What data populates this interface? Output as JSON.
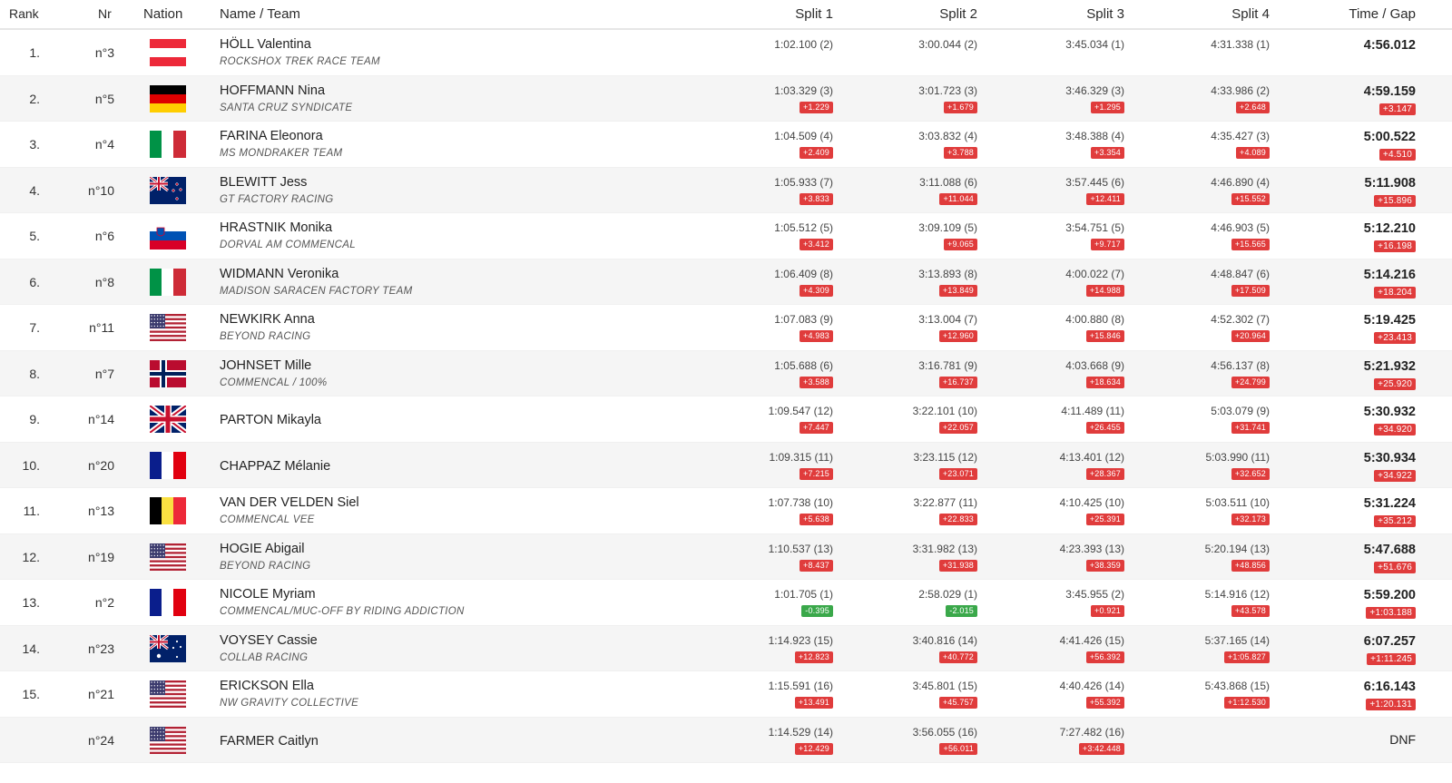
{
  "header": {
    "rank": "Rank",
    "nr": "Nr",
    "nation": "Nation",
    "name_team": "Name / Team",
    "split1": "Split 1",
    "split2": "Split 2",
    "split3": "Split 3",
    "split4": "Split 4",
    "time_gap": "Time / Gap"
  },
  "rows": [
    {
      "rank": "1.",
      "nr": "n°3",
      "flag": "AUT",
      "name": "HÖLL Valentina",
      "team": "ROCKSHOX TREK RACE TEAM",
      "s1": "1:02.100 (2)",
      "g1": "",
      "s2": "3:00.044 (2)",
      "g2": "",
      "s3": "3:45.034 (1)",
      "g3": "",
      "s4": "4:31.338 (1)",
      "g4": "",
      "time": "4:56.012",
      "gap": ""
    },
    {
      "rank": "2.",
      "nr": "n°5",
      "flag": "GER",
      "name": "HOFFMANN Nina",
      "team": "SANTA CRUZ SYNDICATE",
      "s1": "1:03.329 (3)",
      "g1": "+1.229",
      "s2": "3:01.723 (3)",
      "g2": "+1.679",
      "s3": "3:46.329 (3)",
      "g3": "+1.295",
      "s4": "4:33.986 (2)",
      "g4": "+2.648",
      "time": "4:59.159",
      "gap": "+3.147"
    },
    {
      "rank": "3.",
      "nr": "n°4",
      "flag": "ITA",
      "name": "FARINA Eleonora",
      "team": "MS MONDRAKER TEAM",
      "s1": "1:04.509 (4)",
      "g1": "+2.409",
      "s2": "3:03.832 (4)",
      "g2": "+3.788",
      "s3": "3:48.388 (4)",
      "g3": "+3.354",
      "s4": "4:35.427 (3)",
      "g4": "+4.089",
      "time": "5:00.522",
      "gap": "+4.510"
    },
    {
      "rank": "4.",
      "nr": "n°10",
      "flag": "NZL",
      "name": "BLEWITT Jess",
      "team": "GT FACTORY RACING",
      "s1": "1:05.933 (7)",
      "g1": "+3.833",
      "s2": "3:11.088 (6)",
      "g2": "+11.044",
      "s3": "3:57.445 (6)",
      "g3": "+12.411",
      "s4": "4:46.890 (4)",
      "g4": "+15.552",
      "time": "5:11.908",
      "gap": "+15.896"
    },
    {
      "rank": "5.",
      "nr": "n°6",
      "flag": "SLO",
      "name": "HRASTNIK Monika",
      "team": "DORVAL AM COMMENCAL",
      "s1": "1:05.512 (5)",
      "g1": "+3.412",
      "s2": "3:09.109 (5)",
      "g2": "+9.065",
      "s3": "3:54.751 (5)",
      "g3": "+9.717",
      "s4": "4:46.903 (5)",
      "g4": "+15.565",
      "time": "5:12.210",
      "gap": "+16.198"
    },
    {
      "rank": "6.",
      "nr": "n°8",
      "flag": "ITA",
      "name": "WIDMANN Veronika",
      "team": "MADISON SARACEN FACTORY TEAM",
      "s1": "1:06.409 (8)",
      "g1": "+4.309",
      "s2": "3:13.893 (8)",
      "g2": "+13.849",
      "s3": "4:00.022 (7)",
      "g3": "+14.988",
      "s4": "4:48.847 (6)",
      "g4": "+17.509",
      "time": "5:14.216",
      "gap": "+18.204"
    },
    {
      "rank": "7.",
      "nr": "n°11",
      "flag": "USA",
      "name": "NEWKIRK Anna",
      "team": "BEYOND RACING",
      "s1": "1:07.083 (9)",
      "g1": "+4.983",
      "s2": "3:13.004 (7)",
      "g2": "+12.960",
      "s3": "4:00.880 (8)",
      "g3": "+15.846",
      "s4": "4:52.302 (7)",
      "g4": "+20.964",
      "time": "5:19.425",
      "gap": "+23.413"
    },
    {
      "rank": "8.",
      "nr": "n°7",
      "flag": "NOR",
      "name": "JOHNSET Mille",
      "team": "COMMENCAL / 100%",
      "s1": "1:05.688 (6)",
      "g1": "+3.588",
      "s2": "3:16.781 (9)",
      "g2": "+16.737",
      "s3": "4:03.668 (9)",
      "g3": "+18.634",
      "s4": "4:56.137 (8)",
      "g4": "+24.799",
      "time": "5:21.932",
      "gap": "+25.920"
    },
    {
      "rank": "9.",
      "nr": "n°14",
      "flag": "GBR",
      "name": "PARTON Mikayla",
      "team": "",
      "s1": "1:09.547 (12)",
      "g1": "+7.447",
      "s2": "3:22.101 (10)",
      "g2": "+22.057",
      "s3": "4:11.489 (11)",
      "g3": "+26.455",
      "s4": "5:03.079 (9)",
      "g4": "+31.741",
      "time": "5:30.932",
      "gap": "+34.920"
    },
    {
      "rank": "10.",
      "nr": "n°20",
      "flag": "FRA",
      "name": "CHAPPAZ Mélanie",
      "team": "",
      "s1": "1:09.315 (11)",
      "g1": "+7.215",
      "s2": "3:23.115 (12)",
      "g2": "+23.071",
      "s3": "4:13.401 (12)",
      "g3": "+28.367",
      "s4": "5:03.990 (11)",
      "g4": "+32.652",
      "time": "5:30.934",
      "gap": "+34.922"
    },
    {
      "rank": "11.",
      "nr": "n°13",
      "flag": "BEL",
      "name": "VAN DER VELDEN Siel",
      "team": "COMMENCAL VEE",
      "s1": "1:07.738 (10)",
      "g1": "+5.638",
      "s2": "3:22.877 (11)",
      "g2": "+22.833",
      "s3": "4:10.425 (10)",
      "g3": "+25.391",
      "s4": "5:03.511 (10)",
      "g4": "+32.173",
      "time": "5:31.224",
      "gap": "+35.212"
    },
    {
      "rank": "12.",
      "nr": "n°19",
      "flag": "USA",
      "name": "HOGIE Abigail",
      "team": "BEYOND RACING",
      "s1": "1:10.537 (13)",
      "g1": "+8.437",
      "s2": "3:31.982 (13)",
      "g2": "+31.938",
      "s3": "4:23.393 (13)",
      "g3": "+38.359",
      "s4": "5:20.194 (13)",
      "g4": "+48.856",
      "time": "5:47.688",
      "gap": "+51.676"
    },
    {
      "rank": "13.",
      "nr": "n°2",
      "flag": "FRA",
      "name": "NICOLE Myriam",
      "team": "COMMENCAL/MUC-OFF BY RIDING ADDICTION",
      "s1": "1:01.705 (1)",
      "g1": "-0.395",
      "s2": "2:58.029 (1)",
      "g2": "-2.015",
      "s3": "3:45.955 (2)",
      "g3": "+0.921",
      "s4": "5:14.916 (12)",
      "g4": "+43.578",
      "time": "5:59.200",
      "gap": "+1:03.188"
    },
    {
      "rank": "14.",
      "nr": "n°23",
      "flag": "AUS",
      "name": "VOYSEY Cassie",
      "team": "COLLAB RACING",
      "s1": "1:14.923 (15)",
      "g1": "+12.823",
      "s2": "3:40.816 (14)",
      "g2": "+40.772",
      "s3": "4:41.426 (15)",
      "g3": "+56.392",
      "s4": "5:37.165 (14)",
      "g4": "+1:05.827",
      "time": "6:07.257",
      "gap": "+1:11.245"
    },
    {
      "rank": "15.",
      "nr": "n°21",
      "flag": "USA",
      "name": "ERICKSON Ella",
      "team": "NW GRAVITY COLLECTIVE",
      "s1": "1:15.591 (16)",
      "g1": "+13.491",
      "s2": "3:45.801 (15)",
      "g2": "+45.757",
      "s3": "4:40.426 (14)",
      "g3": "+55.392",
      "s4": "5:43.868 (15)",
      "g4": "+1:12.530",
      "time": "6:16.143",
      "gap": "+1:20.131"
    },
    {
      "rank": "",
      "nr": "n°24",
      "flag": "USA",
      "name": "FARMER Caitlyn",
      "team": "",
      "s1": "1:14.529 (14)",
      "g1": "+12.429",
      "s2": "3:56.055 (16)",
      "g2": "+56.011",
      "s3": "7:27.482 (16)",
      "g3": "+3:42.448",
      "s4": "",
      "g4": "",
      "time": "",
      "gap": "",
      "status": "DNF"
    }
  ],
  "colors": {
    "gap_positive": "#e03c3c",
    "gap_negative": "#3aa84a",
    "row_alt": "#f5f5f5"
  }
}
